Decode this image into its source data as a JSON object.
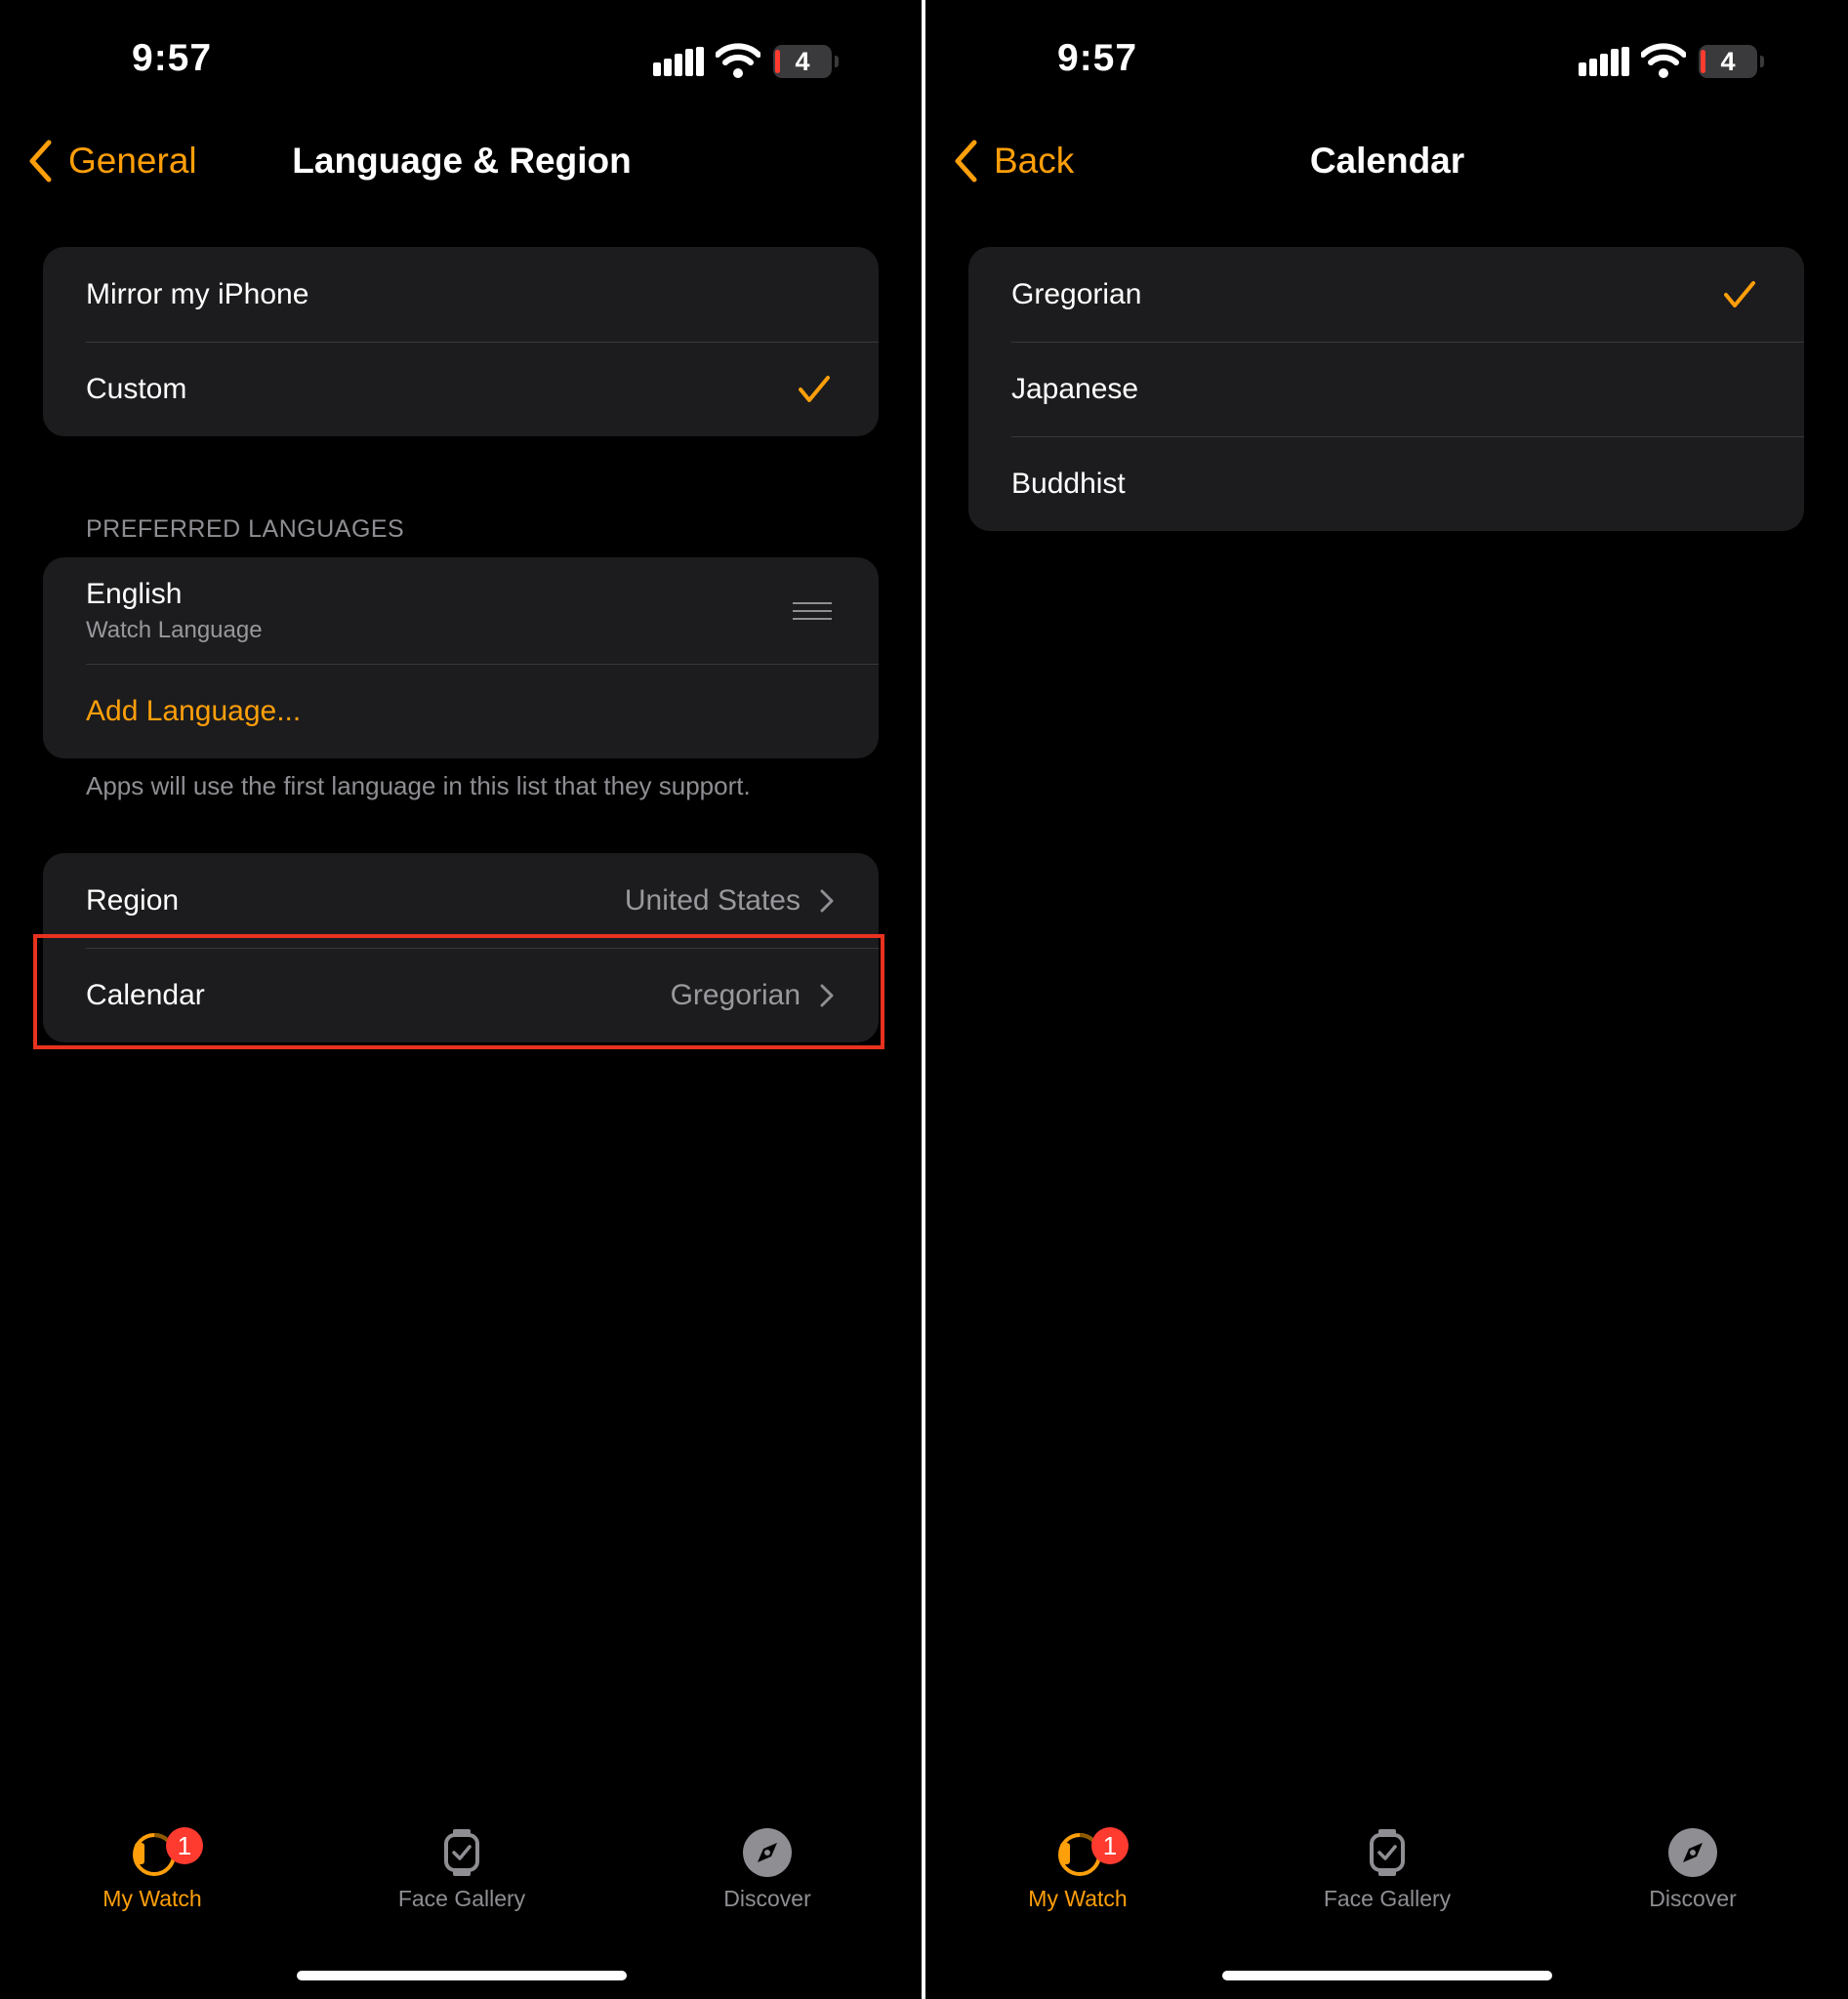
{
  "left": {
    "status": {
      "time": "9:57",
      "battery": "4"
    },
    "nav": {
      "back_label": "General",
      "title": "Language & Region"
    },
    "mode_options": [
      {
        "label": "Mirror my iPhone",
        "selected": false
      },
      {
        "label": "Custom",
        "selected": true
      }
    ],
    "preferred_languages_header": "PREFERRED LANGUAGES",
    "language": {
      "name": "English",
      "subtitle": "Watch Language"
    },
    "add_language_label": "Add Language...",
    "footnote": "Apps will use the first language in this list that they support.",
    "region": {
      "label": "Region",
      "value": "United States"
    },
    "calendar": {
      "label": "Calendar",
      "value": "Gregorian"
    },
    "tabs": {
      "my_watch": "My Watch",
      "face_gallery": "Face Gallery",
      "discover": "Discover",
      "badge": "1"
    }
  },
  "right": {
    "status": {
      "time": "9:57",
      "battery": "4"
    },
    "nav": {
      "back_label": "Back",
      "title": "Calendar"
    },
    "calendar_options": [
      {
        "label": "Gregorian",
        "selected": true
      },
      {
        "label": "Japanese",
        "selected": false
      },
      {
        "label": "Buddhist",
        "selected": false
      }
    ],
    "tabs": {
      "my_watch": "My Watch",
      "face_gallery": "Face Gallery",
      "discover": "Discover",
      "badge": "1"
    }
  },
  "colors": {
    "accent": "#ff9f0a",
    "highlight_box": "#e8321f",
    "badge": "#ff3b30",
    "cell_bg": "#1c1c1e"
  }
}
